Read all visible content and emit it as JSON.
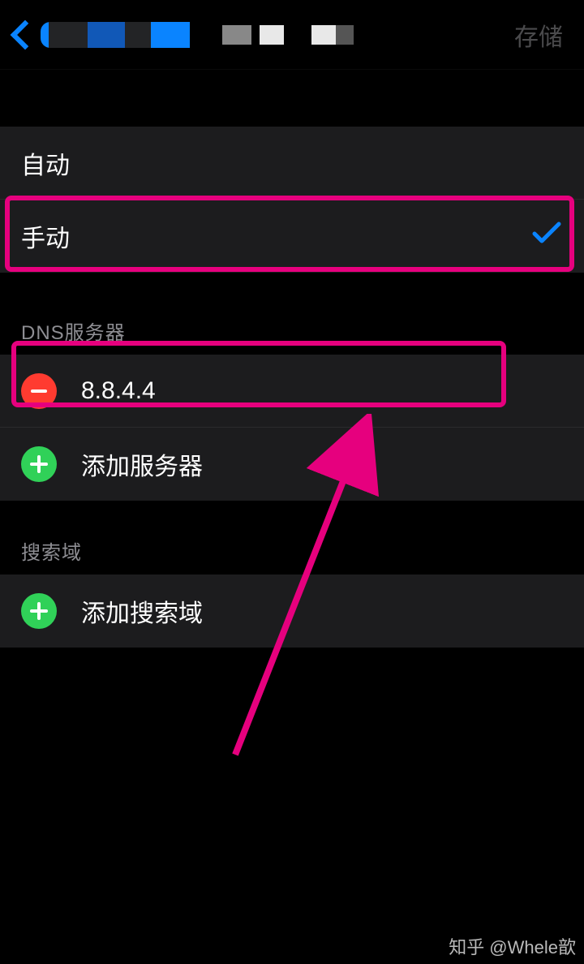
{
  "header": {
    "save_label": "存储"
  },
  "mode": {
    "auto_label": "自动",
    "manual_label": "手动"
  },
  "dns": {
    "section_title": "DNS服务器",
    "server_value": "8.8.4.4",
    "add_label": "添加服务器"
  },
  "search_domain": {
    "section_title": "搜索域",
    "add_label": "添加搜索域"
  },
  "watermark": "知乎 @Whele歆",
  "colors": {
    "accent_blue": "#0a84ff",
    "highlight_pink": "#e6007e",
    "add_green": "#30d158",
    "remove_red": "#ff3b30"
  }
}
